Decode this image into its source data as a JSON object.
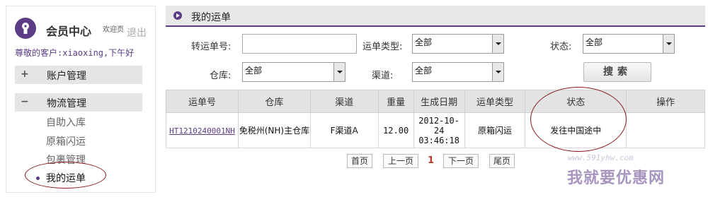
{
  "sidebar": {
    "title": "会员中心",
    "welcome": "欢迎页",
    "logout": "退出",
    "greeting": "尊敬的客户:xiaoxing,下午好",
    "groups": [
      {
        "sign": "+",
        "label": "账户管理"
      },
      {
        "sign": "−",
        "label": "物流管理"
      }
    ],
    "items": [
      "自助入库",
      "原箱闪运",
      "包裹管理",
      "我的运单"
    ]
  },
  "main": {
    "title": "我的运单"
  },
  "filters": {
    "transfer_no_label": "转运单号:",
    "transfer_no_value": "",
    "waybill_type_label": "运单类型:",
    "waybill_type_value": "全部",
    "status_label": "状态:",
    "status_value": "全部",
    "warehouse_label": "仓库:",
    "warehouse_value": "全部",
    "channel_label": "渠道:",
    "channel_value": "全部",
    "search_button": "搜索"
  },
  "table": {
    "headers": [
      "运单号",
      "仓库",
      "渠道",
      "重量",
      "生成日期",
      "运单类型",
      "状态",
      "操作"
    ],
    "rows": [
      {
        "waybill_no": "HT1210240001NH",
        "warehouse": "免税州(NH)主仓库",
        "channel": "F渠道A",
        "weight": "12.00",
        "date": "2012-10-24",
        "time": "03:46:18",
        "type": "原箱闪运",
        "status": "发往中国途中",
        "action": ""
      }
    ]
  },
  "pagination": {
    "first": "首页",
    "prev": "上一页",
    "current": "1",
    "next": "下一页",
    "last": "尾页"
  },
  "watermark": {
    "url": "www.591yhw.com",
    "text": "我就要优惠网"
  },
  "colors": {
    "accent": "#5b3c85",
    "annotation": "#8b1a1a",
    "current_page": "#c0392b"
  }
}
